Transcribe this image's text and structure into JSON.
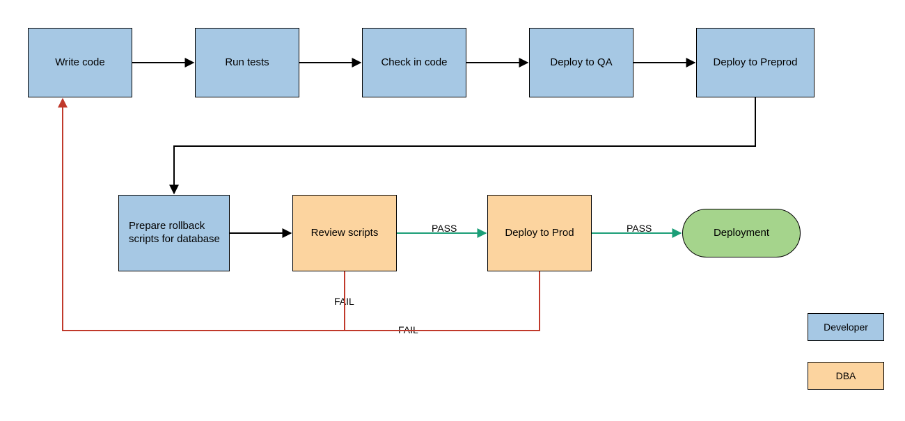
{
  "nodes": {
    "write_code": {
      "label": "Write code",
      "role": "developer"
    },
    "run_tests": {
      "label": "Run tests",
      "role": "developer"
    },
    "check_in_code": {
      "label": "Check in code",
      "role": "developer"
    },
    "deploy_qa": {
      "label": "Deploy to QA",
      "role": "developer"
    },
    "deploy_preprod": {
      "label": "Deploy to Preprod",
      "role": "developer"
    },
    "prepare_rollback": {
      "label": "Prepare rollback scripts for database",
      "role": "developer"
    },
    "review_scripts": {
      "label": "Review scripts",
      "role": "dba"
    },
    "deploy_prod": {
      "label": "Deploy to Prod",
      "role": "dba"
    },
    "deployment": {
      "label": "Deployment",
      "role": "terminal"
    }
  },
  "edges": {
    "review_to_deploy_pass": {
      "label": "PASS"
    },
    "deploy_to_done_pass": {
      "label": "PASS"
    },
    "review_fail": {
      "label": "FAIL"
    },
    "deploy_fail": {
      "label": "FAIL"
    }
  },
  "legend": {
    "developer": "Developer",
    "dba": "DBA"
  },
  "colors": {
    "developer": "#a6c8e4",
    "dba": "#fcd49f",
    "terminal": "#a5d48c",
    "arrow_default": "#000000",
    "arrow_pass": "#1b9e77",
    "arrow_fail": "#c0392b"
  },
  "chart_data": {
    "type": "flowchart",
    "nodes": [
      {
        "id": "write_code",
        "label": "Write code",
        "role": "developer",
        "shape": "rect"
      },
      {
        "id": "run_tests",
        "label": "Run tests",
        "role": "developer",
        "shape": "rect"
      },
      {
        "id": "check_in_code",
        "label": "Check in code",
        "role": "developer",
        "shape": "rect"
      },
      {
        "id": "deploy_qa",
        "label": "Deploy to QA",
        "role": "developer",
        "shape": "rect"
      },
      {
        "id": "deploy_preprod",
        "label": "Deploy to Preprod",
        "role": "developer",
        "shape": "rect"
      },
      {
        "id": "prepare_rollback",
        "label": "Prepare rollback scripts for database",
        "role": "developer",
        "shape": "rect"
      },
      {
        "id": "review_scripts",
        "label": "Review scripts",
        "role": "dba",
        "shape": "rect"
      },
      {
        "id": "deploy_prod",
        "label": "Deploy to Prod",
        "role": "dba",
        "shape": "rect"
      },
      {
        "id": "deployment",
        "label": "Deployment",
        "role": "terminal",
        "shape": "rounded"
      }
    ],
    "edges": [
      {
        "from": "write_code",
        "to": "run_tests",
        "label": "",
        "style": "default"
      },
      {
        "from": "run_tests",
        "to": "check_in_code",
        "label": "",
        "style": "default"
      },
      {
        "from": "check_in_code",
        "to": "deploy_qa",
        "label": "",
        "style": "default"
      },
      {
        "from": "deploy_qa",
        "to": "deploy_preprod",
        "label": "",
        "style": "default"
      },
      {
        "from": "deploy_preprod",
        "to": "prepare_rollback",
        "label": "",
        "style": "default"
      },
      {
        "from": "prepare_rollback",
        "to": "review_scripts",
        "label": "",
        "style": "default"
      },
      {
        "from": "review_scripts",
        "to": "deploy_prod",
        "label": "PASS",
        "style": "pass"
      },
      {
        "from": "deploy_prod",
        "to": "deployment",
        "label": "PASS",
        "style": "pass"
      },
      {
        "from": "review_scripts",
        "to": "write_code",
        "label": "FAIL",
        "style": "fail"
      },
      {
        "from": "deploy_prod",
        "to": "write_code",
        "label": "FAIL",
        "style": "fail"
      }
    ],
    "legend": [
      {
        "role": "developer",
        "label": "Developer",
        "color": "#a6c8e4"
      },
      {
        "role": "dba",
        "label": "DBA",
        "color": "#fcd49f"
      }
    ]
  }
}
